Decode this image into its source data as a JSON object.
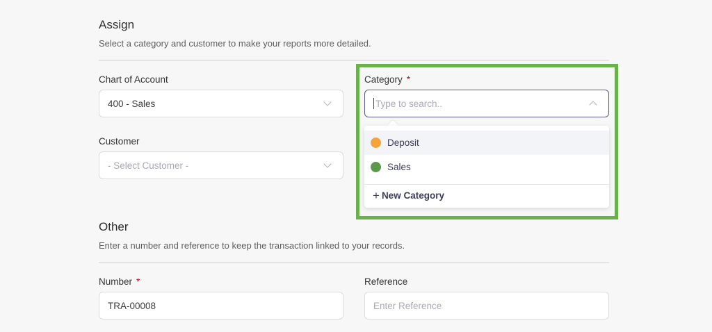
{
  "assign": {
    "title": "Assign",
    "description": "Select a category and customer to make your reports more detailed."
  },
  "chart_of_account": {
    "label": "Chart of Account",
    "value": "400 - Sales"
  },
  "category": {
    "label": "Category",
    "required_mark": "*",
    "placeholder": "Type to search..",
    "options": [
      {
        "label": "Deposit",
        "color": "#f5a33c"
      },
      {
        "label": "Sales",
        "color": "#5b9a4a"
      }
    ],
    "new_label": "New Category",
    "plus_symbol": "+",
    "highlight_color": "#6ab04c"
  },
  "customer": {
    "label": "Customer",
    "placeholder": "- Select Customer -"
  },
  "other": {
    "title": "Other",
    "description": "Enter a number and reference to keep the transaction linked to your records."
  },
  "number": {
    "label": "Number",
    "required_mark": "*",
    "value": "TRA-00008"
  },
  "reference": {
    "label": "Reference",
    "placeholder": "Enter Reference"
  }
}
